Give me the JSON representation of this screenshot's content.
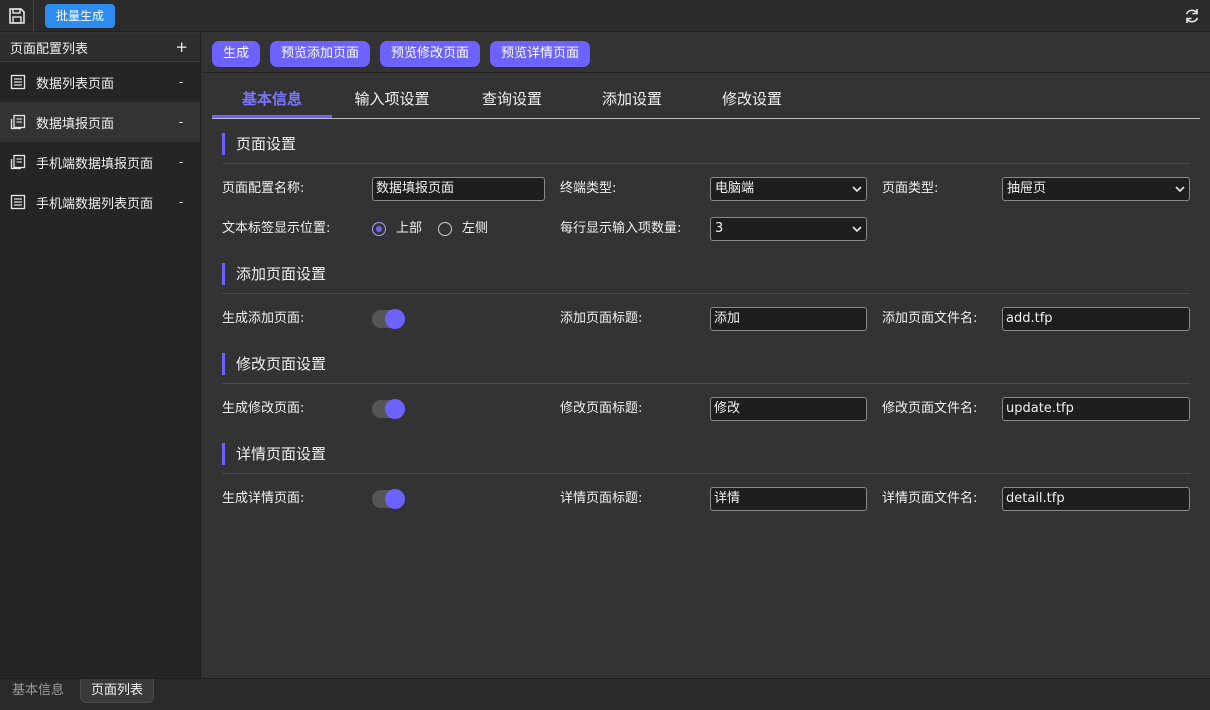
{
  "toolbar": {
    "batch_label": "批量生成"
  },
  "sidebar": {
    "title": "页面配置列表",
    "add_symbol": "+",
    "items": [
      {
        "label": "数据列表页面",
        "icon": "list-page-icon",
        "minus": "-"
      },
      {
        "label": "数据填报页面",
        "icon": "form-page-icon",
        "minus": "-"
      },
      {
        "label": "手机端数据填报页面",
        "icon": "form-page-icon",
        "minus": "-"
      },
      {
        "label": "手机端数据列表页面",
        "icon": "list-page-icon",
        "minus": "-"
      }
    ],
    "active_index": 1
  },
  "actions": [
    "生成",
    "预览添加页面",
    "预览修改页面",
    "预览详情页面"
  ],
  "tabs": [
    "基本信息",
    "输入项设置",
    "查询设置",
    "添加设置",
    "修改设置"
  ],
  "active_tab": 0,
  "page_settings": {
    "title": "页面设置",
    "name_label": "页面配置名称:",
    "name_value": "数据填报页面",
    "terminal_label": "终端类型:",
    "terminal_value": "电脑端",
    "type_label": "页面类型:",
    "type_value": "抽屉页",
    "label_pos_label": "文本标签显示位置:",
    "label_pos_top": "上部",
    "label_pos_left": "左侧",
    "label_pos_selected": "上部",
    "per_row_label": "每行显示输入项数量:",
    "per_row_value": "3"
  },
  "add_settings": {
    "title": "添加页面设置",
    "gen_label": "生成添加页面:",
    "gen_on": true,
    "title_label": "添加页面标题:",
    "title_value": "添加",
    "file_label": "添加页面文件名:",
    "file_value": "add.tfp"
  },
  "update_settings": {
    "title": "修改页面设置",
    "gen_label": "生成修改页面:",
    "gen_on": true,
    "title_label": "修改页面标题:",
    "title_value": "修改",
    "file_label": "修改页面文件名:",
    "file_value": "update.tfp"
  },
  "detail_settings": {
    "title": "详情页面设置",
    "gen_label": "生成详情页面:",
    "gen_on": true,
    "title_label": "详情页面标题:",
    "title_value": "详情",
    "file_label": "详情页面文件名:",
    "file_value": "detail.tfp"
  },
  "bottom_tabs": [
    "基本信息",
    "页面列表"
  ],
  "bottom_active": 1,
  "colors": {
    "accent": "#6c63ff",
    "batch_button": "#2d8cf0",
    "background": "#333333"
  }
}
